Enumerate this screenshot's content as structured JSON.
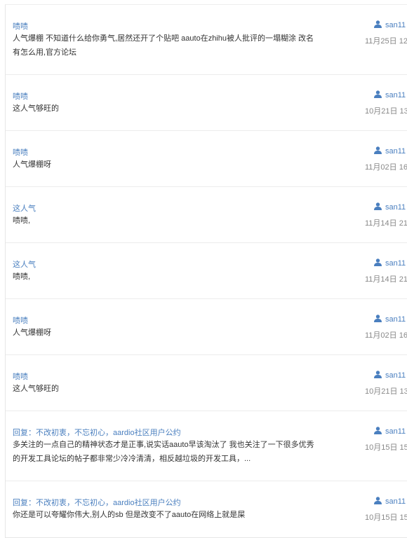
{
  "posts": [
    {
      "title": "啧啧",
      "content": "人气爆棚 不知道什么给你勇气,居然还开了个贴吧 aauto在zhihu被人批评的一塌糊涂 改名有怎么用,官方论坛",
      "user": "san11",
      "date": "11月25日 12"
    },
    {
      "title": "啧啧",
      "content": "这人气够旺的",
      "user": "san11",
      "date": "10月21日 13"
    },
    {
      "title": "啧啧",
      "content": "人气爆棚呀",
      "user": "san11",
      "date": "11月02日 16"
    },
    {
      "title": "这人气",
      "content": "啧啧,",
      "user": "san11",
      "date": "11月14日 21"
    },
    {
      "title": "这人气",
      "content": "啧啧,",
      "user": "san11",
      "date": "11月14日 21"
    },
    {
      "title": "啧啧",
      "content": "人气爆棚呀",
      "user": "san11",
      "date": "11月02日 16"
    },
    {
      "title": "啧啧",
      "content": "这人气够旺的",
      "user": "san11",
      "date": "10月21日 13"
    },
    {
      "title": "回复：不改初衷，不忘初心，aardio社区用户公约",
      "content": "多关注的一点自己的精神状态才是正事,说实话aauto早该淘汰了 我也关注了一下很多优秀的开发工具论坛的帖子都非常少冷冷清清，相反越垃圾的开发工具，...",
      "user": "san11",
      "date": "10月15日 15"
    },
    {
      "title": "回复：不改初衷，不忘初心，aardio社区用户公约",
      "content": "你还是可以夸耀你伟大,别人的sb 但是改变不了aauto在网络上就是屎",
      "user": "san11",
      "date": "10月15日 15"
    }
  ],
  "icons": {
    "user": "user-icon"
  },
  "colors": {
    "link": "#4a7fbf",
    "text": "#333333",
    "muted": "#888888",
    "divider": "#ececec"
  }
}
